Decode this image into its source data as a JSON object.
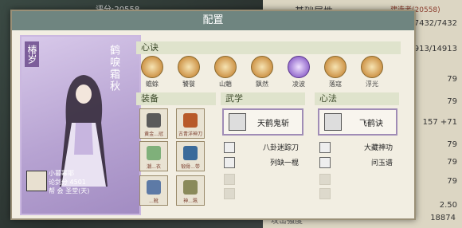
{
  "background": {
    "left_text": "评分:20558",
    "title": "基础属性",
    "right_label": "建造者(20558)",
    "numbers": [
      "7432/7432",
      "14913/14913",
      "79",
      "79",
      "157 +71",
      "79",
      "79",
      "79",
      "2.50"
    ],
    "footer_label": "攻击强度",
    "footer_value": "18874"
  },
  "dialog": {
    "title": "配置",
    "close": "✕"
  },
  "character": {
    "name": "椿岁",
    "title": "鹤唳霜秋",
    "info_line1": "小暮幂耶",
    "info_line2": "论剑分 4501",
    "info_line3": "帮  会 圣堂(天)"
  },
  "sections": {
    "xinjue": "心诀",
    "equipment": "装备",
    "wuxue": "武学",
    "xinfa": "心法"
  },
  "xinjue_items": [
    {
      "label": "蟾蜍",
      "icon": "gold-emblem-icon"
    },
    {
      "label": "饕餮",
      "icon": "gold-emblem-icon"
    },
    {
      "label": "山魈",
      "icon": "gold-emblem-icon"
    },
    {
      "label": "飘然",
      "icon": "gold-emblem-icon"
    },
    {
      "label": "凌波",
      "icon": "purple-emblem-icon"
    },
    {
      "label": "落寇",
      "icon": "gold-emblem-icon"
    },
    {
      "label": "浮光",
      "icon": "gold-emblem-icon"
    }
  ],
  "equipment_items": [
    {
      "label": "黄金...冠",
      "icon": "helmet-icon"
    },
    {
      "label": "古青洋神刀",
      "icon": "blade-icon"
    },
    {
      "label": "潮...衣",
      "icon": "robe-icon"
    },
    {
      "label": "锻骨...带",
      "icon": "belt-icon"
    },
    {
      "label": "...靴",
      "icon": "boots-icon"
    },
    {
      "label": "神...珮",
      "icon": "pendant-icon"
    }
  ],
  "wuxue": {
    "main": "天鹤鬼斩",
    "sub": [
      "八卦迷踪刀",
      "列缺一棍"
    ]
  },
  "xinfa": {
    "main": "飞鹤诀",
    "sub": [
      "大藏神功",
      "问玉谱"
    ]
  },
  "colors": {
    "header": "#6f8580",
    "dialog_bg": "#f2eee2",
    "portrait": "#b7a3d2",
    "section_bar": "#dfe3cc"
  }
}
